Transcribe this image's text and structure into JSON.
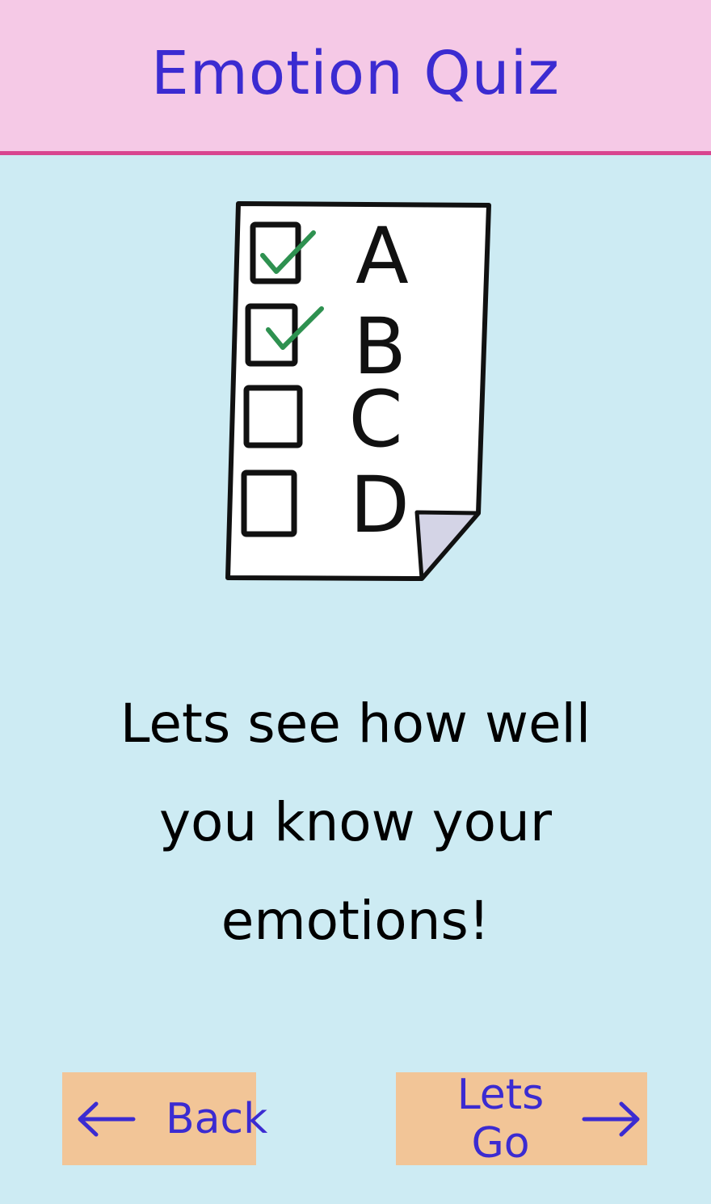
{
  "header": {
    "title": "Emotion Quiz",
    "background": "#f5c9e6",
    "border_color": "#d8458f",
    "title_color": "#3b2bd1"
  },
  "illustration": {
    "icon": "quiz-checklist-icon",
    "options": [
      "A",
      "B",
      "C",
      "D"
    ],
    "checked": [
      true,
      true,
      false,
      false
    ],
    "check_color": "#2e9150"
  },
  "message": {
    "line1": "Lets see how well",
    "line2": "you know your",
    "line3": "emotions!"
  },
  "nav": {
    "back_label": "Back",
    "back_icon": "arrow-left-icon",
    "go_label": "Lets Go",
    "go_icon": "arrow-right-icon",
    "button_color": "#f2c597"
  },
  "background": "#cdebf3"
}
